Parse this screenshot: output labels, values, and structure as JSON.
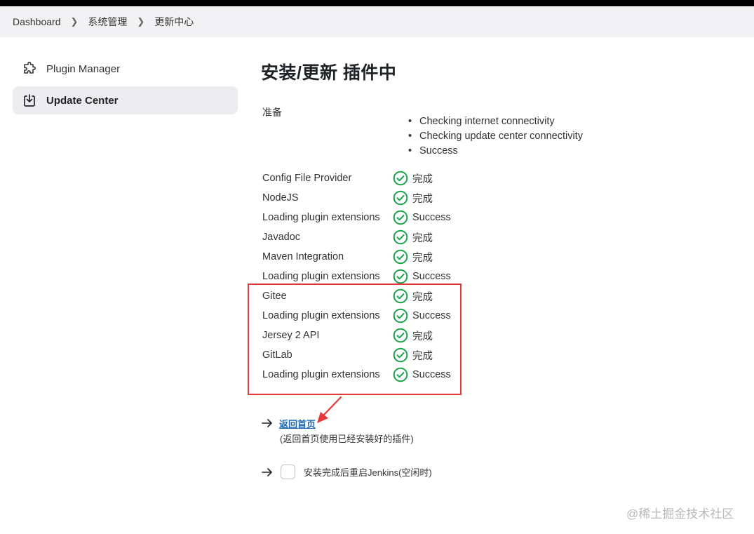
{
  "breadcrumb": {
    "items": [
      "Dashboard",
      "系统管理",
      "更新中心"
    ]
  },
  "sidebar": {
    "items": [
      {
        "label": "Plugin Manager",
        "icon": "puzzle-icon"
      },
      {
        "label": "Update Center",
        "icon": "download-icon",
        "active": true
      }
    ]
  },
  "main": {
    "title": "安装/更新 插件中",
    "prepare_label": "准备",
    "prepare_steps": [
      "Checking internet connectivity",
      "Checking update center connectivity",
      "Success"
    ],
    "plugins": [
      {
        "name": "Config File Provider",
        "status": "完成"
      },
      {
        "name": "NodeJS",
        "status": "完成"
      },
      {
        "name": "Loading plugin extensions",
        "status": "Success"
      },
      {
        "name": "Javadoc",
        "status": "完成"
      },
      {
        "name": "Maven Integration",
        "status": "完成"
      },
      {
        "name": "Loading plugin extensions",
        "status": "Success"
      },
      {
        "name": "Gitee",
        "status": "完成"
      },
      {
        "name": "Loading plugin extensions",
        "status": "Success"
      },
      {
        "name": "Jersey 2 API",
        "status": "完成"
      },
      {
        "name": "GitLab",
        "status": "完成"
      },
      {
        "name": "Loading plugin extensions",
        "status": "Success"
      }
    ],
    "home_link": "返回首页",
    "home_desc": "(返回首页使用已经安装好的插件)",
    "restart_label": "安装完成后重启Jenkins(空闲时)",
    "restart_checked": false
  },
  "colors": {
    "success_green": "#1aa34a",
    "highlight_red": "#e5383b",
    "link_blue": "#1b67b0"
  },
  "watermark": "@稀土掘金技术社区"
}
